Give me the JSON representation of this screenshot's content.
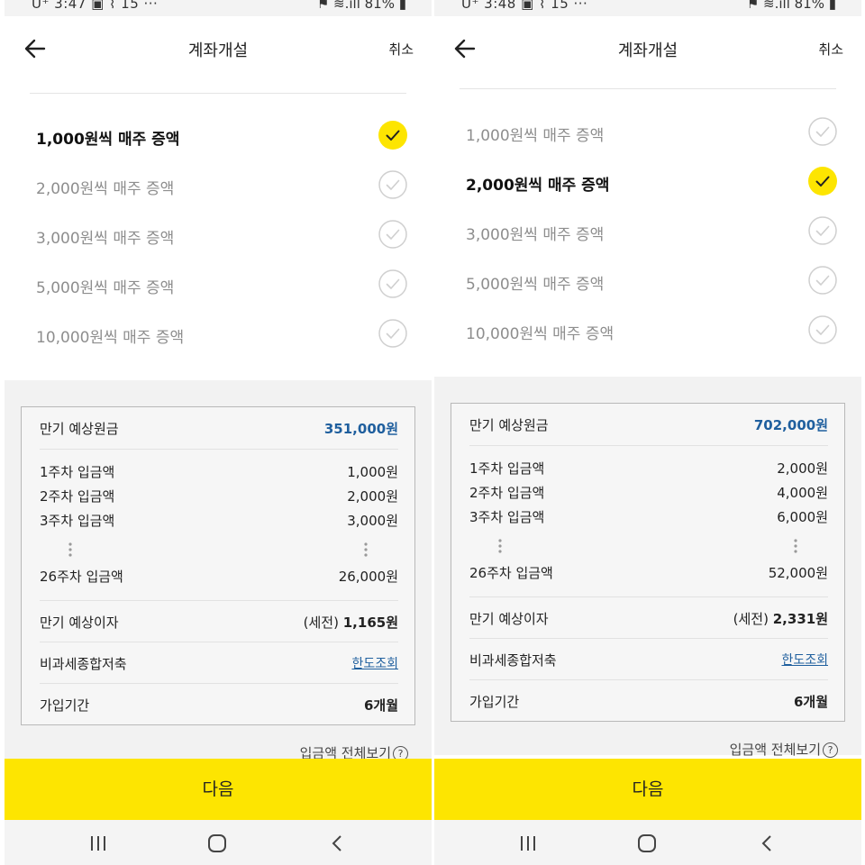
{
  "screens": [
    {
      "status_left": "U⁺ 3:47 ▣ ⌇ 15 ···",
      "status_right": "⚑ ≋.ıll 81% ▮",
      "title": "계좌개설",
      "cancel": "취소",
      "options": [
        {
          "label": "1,000원씩 매주 증액",
          "selected": true
        },
        {
          "label": "2,000원씩 매주 증액",
          "selected": false
        },
        {
          "label": "3,000원씩 매주 증액",
          "selected": false
        },
        {
          "label": "5,000원씩 매주 증액",
          "selected": false
        },
        {
          "label": "10,000원씩 매주 증액",
          "selected": false
        }
      ],
      "summary": {
        "maturity_principal_label": "만기 예상원금",
        "maturity_principal": "351,000원",
        "weeks": [
          {
            "label": "1주차 입금액",
            "value": "1,000원"
          },
          {
            "label": "2주차 입금액",
            "value": "2,000원"
          },
          {
            "label": "3주차 입금액",
            "value": "3,000원"
          },
          {
            "label": "26주차 입금액",
            "value": "26,000원"
          }
        ],
        "interest_label": "만기 예상이자",
        "interest_prefix": "(세전)",
        "interest_value": "1,165원",
        "taxfree_label": "비과세종합저축",
        "taxfree_link": "한도조회",
        "period_label": "가입기간",
        "period_value": "6개월"
      },
      "view_all": "입금액 전체보기",
      "next": "다음"
    },
    {
      "status_left": "U⁺ 3:48 ▣ ⌇ 15 ···",
      "status_right": "⚑ ≋.ıll 81% ▮",
      "title": "계좌개설",
      "cancel": "취소",
      "options": [
        {
          "label": "1,000원씩 매주 증액",
          "selected": false
        },
        {
          "label": "2,000원씩 매주 증액",
          "selected": true
        },
        {
          "label": "3,000원씩 매주 증액",
          "selected": false
        },
        {
          "label": "5,000원씩 매주 증액",
          "selected": false
        },
        {
          "label": "10,000원씩 매주 증액",
          "selected": false
        }
      ],
      "summary": {
        "maturity_principal_label": "만기 예상원금",
        "maturity_principal": "702,000원",
        "weeks": [
          {
            "label": "1주차 입금액",
            "value": "2,000원"
          },
          {
            "label": "2주차 입금액",
            "value": "4,000원"
          },
          {
            "label": "3주차 입금액",
            "value": "6,000원"
          },
          {
            "label": "26주차 입금액",
            "value": "52,000원"
          }
        ],
        "interest_label": "만기 예상이자",
        "interest_prefix": "(세전)",
        "interest_value": "2,331원",
        "taxfree_label": "비과세종합저축",
        "taxfree_link": "한도조회",
        "period_label": "가입기간",
        "period_value": "6개월"
      },
      "view_all": "입금액 전체보기",
      "next": "다음"
    }
  ],
  "colors": {
    "accent_yellow": "#fde501",
    "link_blue": "#1f5f9e",
    "unselected_text": "#8e8e8e"
  },
  "icons": {
    "back": "arrow-left-icon",
    "check": "check-circle-icon",
    "help": "question-circle-icon",
    "nav_recent": "recent-apps-icon",
    "nav_home": "home-icon",
    "nav_back": "chevron-left-icon"
  }
}
